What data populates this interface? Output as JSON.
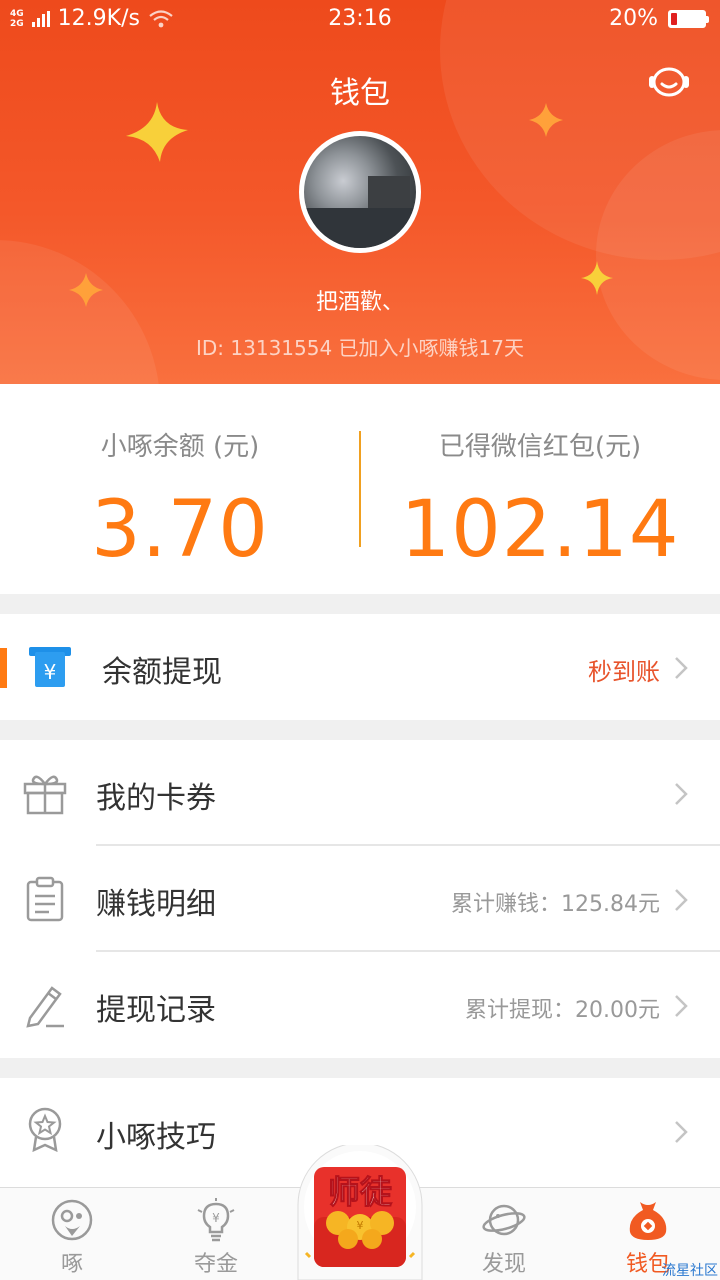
{
  "status": {
    "network_type": "4G\n2G",
    "speed": "12.9K/s",
    "time": "23:16",
    "battery_percent": "20%",
    "battery_level": 0.2
  },
  "header": {
    "title": "钱包",
    "nickname": "把酒歡、",
    "user_meta": "ID: 13131554  已加入小啄赚钱17天"
  },
  "balance": {
    "left_label": "小啄余额 (元)",
    "left_value": "3.70",
    "right_label": "已得微信红包(元)",
    "right_value": "102.14"
  },
  "withdraw": {
    "label": "余额提现",
    "tag": "秒到账"
  },
  "menu": [
    {
      "label": "我的卡券",
      "value": ""
    },
    {
      "label": "赚钱明细",
      "value": "累计赚钱：125.84元"
    },
    {
      "label": "提现记录",
      "value": "累计提现：20.00元"
    }
  ],
  "tips": {
    "label": "小啄技巧"
  },
  "bottom_nav": {
    "items": [
      {
        "label": "啄",
        "icon": "peck-icon"
      },
      {
        "label": "夺金",
        "icon": "bulb-icon"
      },
      {
        "label": "发现",
        "icon": "planet-icon"
      },
      {
        "label": "钱包",
        "icon": "wallet-bag-icon"
      }
    ],
    "center_badge": "师徒"
  },
  "colors": {
    "header": "#f15a22",
    "accent": "#ff7a12",
    "nav_active": "#f15a22",
    "tag": "#e8542c"
  },
  "watermark": "流星社区"
}
